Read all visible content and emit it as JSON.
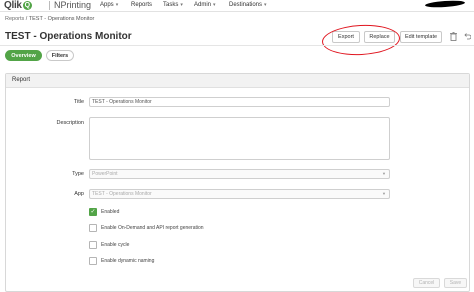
{
  "nav": {
    "brand": "Qlik",
    "brand_q": "Q",
    "product": "NPrinting",
    "items": [
      {
        "label": "Apps",
        "caret": "▾"
      },
      {
        "label": "Reports",
        "caret": ""
      },
      {
        "label": "Tasks",
        "caret": "▾"
      },
      {
        "label": "Admin",
        "caret": "▾"
      },
      {
        "label": "Destinations",
        "caret": "▾"
      }
    ]
  },
  "breadcrumb": {
    "parent": "Reports",
    "separator": " / ",
    "current": "TEST - Operations Monitor"
  },
  "page": {
    "title": "TEST - Operations Monitor",
    "buttons": {
      "export": "Export",
      "replace": "Replace",
      "edit_template": "Edit template"
    },
    "icons": [
      "trash-icon",
      "undo-icon"
    ]
  },
  "tabs": [
    {
      "label": "Overview",
      "active": true
    },
    {
      "label": "Filters",
      "active": false
    }
  ],
  "report": {
    "section_title": "Report",
    "fields": {
      "title_label": "Title",
      "title_value": "TEST - Operations Monitor",
      "description_label": "Description",
      "description_value": "",
      "type_label": "Type",
      "type_value": "PowerPoint",
      "app_label": "App",
      "app_value": "TEST - Operations Monitor"
    },
    "options": [
      {
        "label": "Enabled",
        "checked": true
      },
      {
        "label": "Enable On-Demand and API report generation",
        "checked": false
      },
      {
        "label": "Enable cycle",
        "checked": false
      },
      {
        "label": "Enable dynamic naming",
        "checked": false
      }
    ],
    "actions": {
      "cancel": "Cancel",
      "save": "Save"
    }
  },
  "colors": {
    "accent_green": "#52a447",
    "annotation_red": "#e0151f"
  }
}
